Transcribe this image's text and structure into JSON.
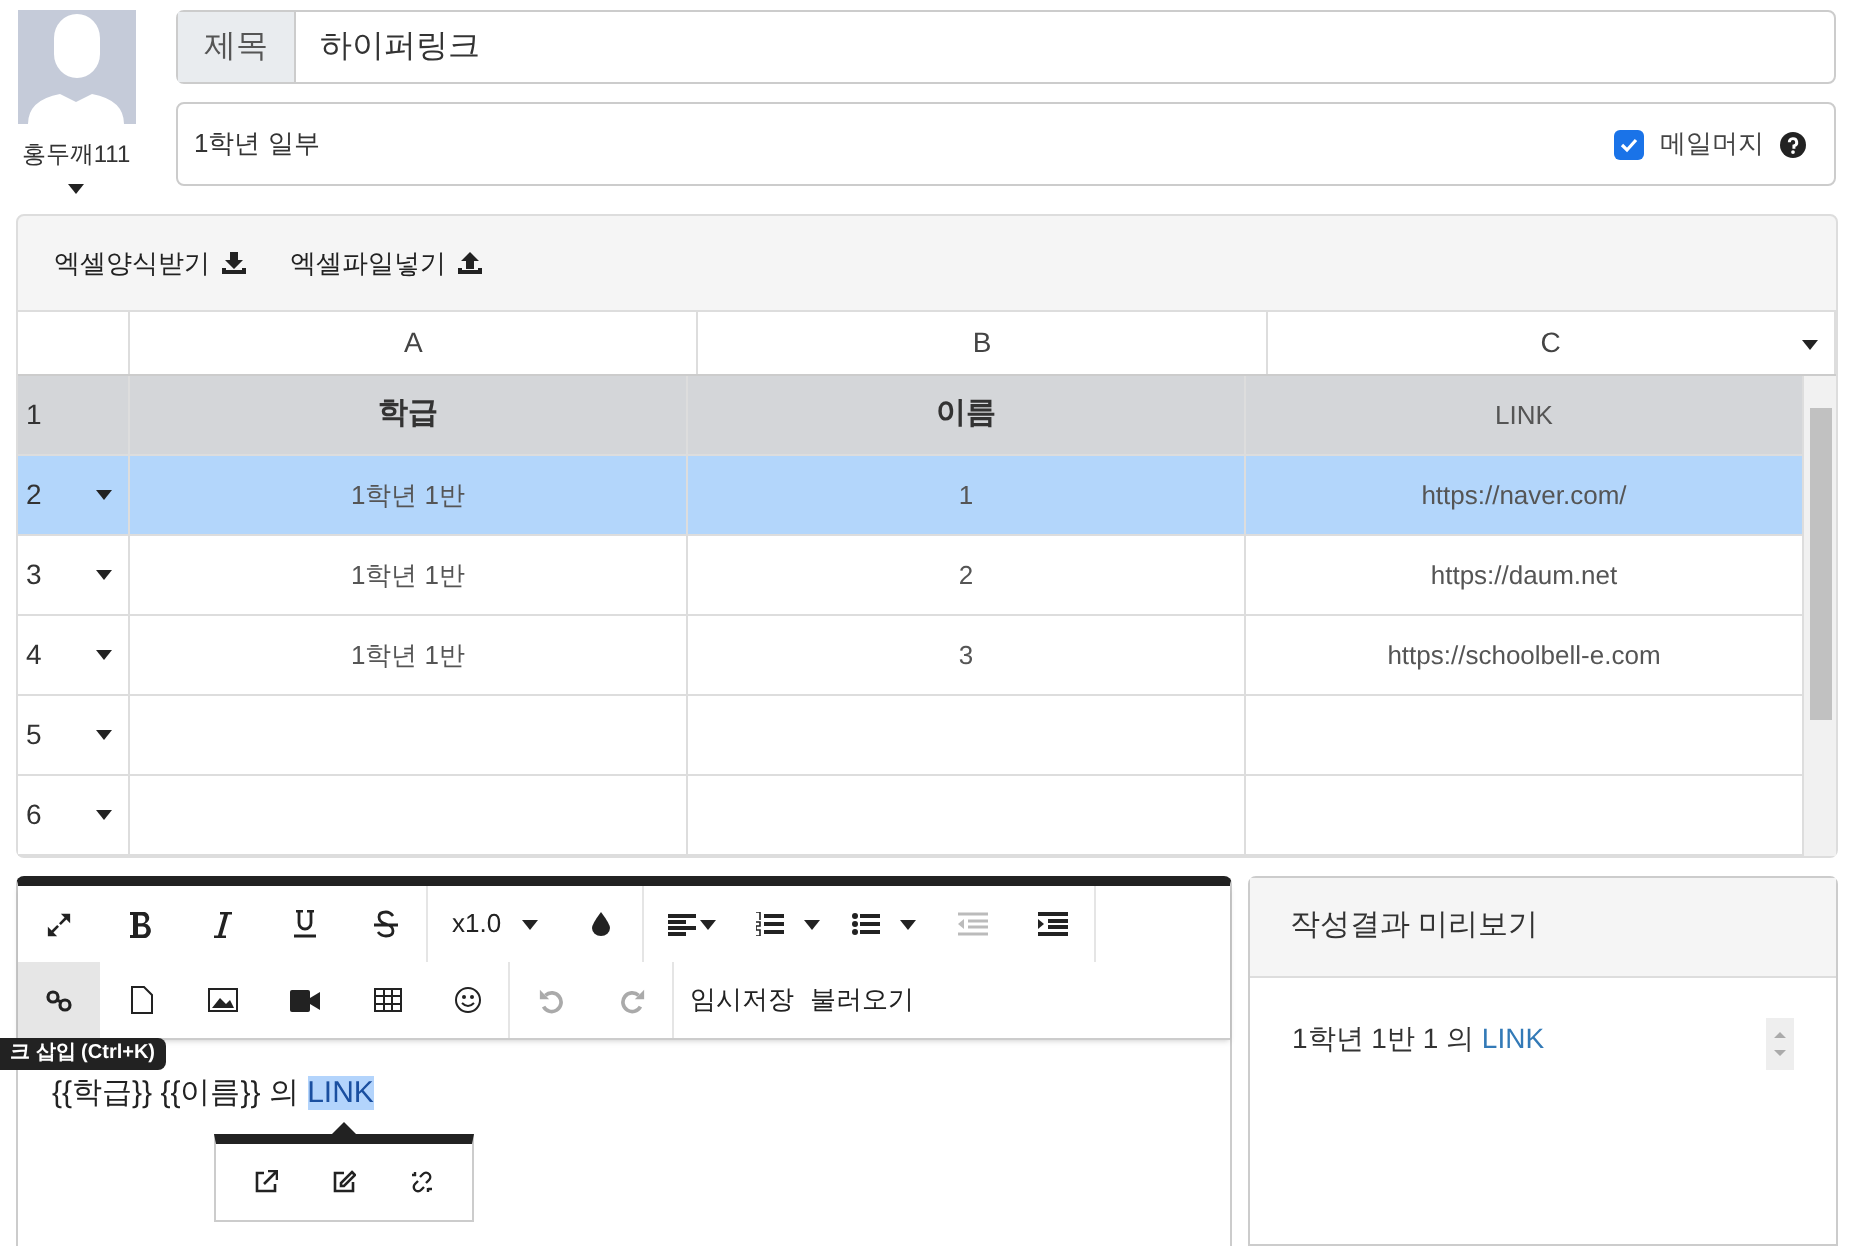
{
  "user": {
    "name": "홍두깨111"
  },
  "title": {
    "label": "제목",
    "value": "하이퍼링크"
  },
  "subtitle": {
    "value": "1학년 일부"
  },
  "mail_merge": {
    "label": "메일머지",
    "checked": true
  },
  "excel_buttons": [
    "엑셀양식받기",
    "엑셀파일넣기"
  ],
  "sheet": {
    "columns": [
      "A",
      "B",
      "C"
    ],
    "rows": [
      {
        "number": "1",
        "kind": "header",
        "selected": false,
        "cells": [
          {
            "text": "학급",
            "bold": true
          },
          {
            "text": "이름",
            "bold": true
          },
          {
            "text": "LINK",
            "bold": false
          }
        ]
      },
      {
        "number": "2",
        "kind": "data",
        "selected": true,
        "cells": [
          "1학년 1반",
          "1",
          "https://naver.com/"
        ]
      },
      {
        "number": "3",
        "kind": "data",
        "selected": false,
        "cells": [
          "1학년 1반",
          "2",
          "https://daum.net"
        ]
      },
      {
        "number": "4",
        "kind": "data",
        "selected": false,
        "cells": [
          "1학년 1반",
          "3",
          "https://schoolbell-e.com"
        ]
      },
      {
        "number": "5",
        "kind": "data",
        "selected": false
      },
      {
        "number": "6",
        "kind": "data",
        "selected": false
      }
    ]
  },
  "editor": {
    "font_scale": "x1.0",
    "link_active": true,
    "text_buttons": [
      "임시저장",
      "불러오기"
    ],
    "tooltip": "크 삽입 (Ctrl+K)",
    "text": "{{학급}} {{이름}} 의",
    "selected_link": "LINK"
  },
  "preview": {
    "title": "작성결과 미리보기",
    "text": "1학년 1반 1 의",
    "link": "LINK"
  }
}
